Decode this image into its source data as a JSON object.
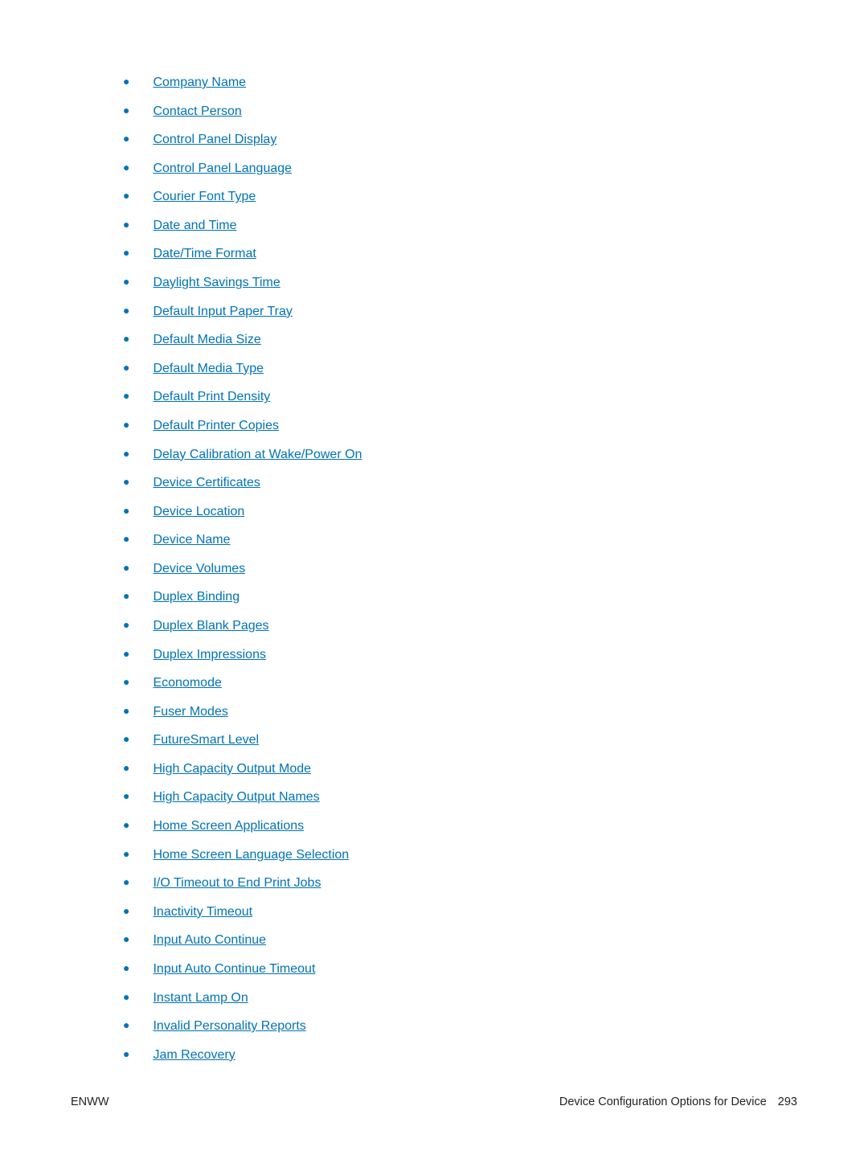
{
  "items": [
    "Company Name",
    "Contact Person",
    "Control Panel Display",
    "Control Panel Language",
    "Courier Font Type",
    "Date and Time",
    "Date/Time Format",
    "Daylight Savings Time",
    "Default Input Paper Tray",
    "Default Media Size",
    "Default Media Type",
    "Default Print Density",
    "Default Printer Copies",
    "Delay Calibration at Wake/Power On",
    "Device Certificates",
    "Device Location",
    "Device Name",
    "Device Volumes",
    "Duplex Binding",
    "Duplex Blank Pages",
    "Duplex Impressions",
    "Economode",
    "Fuser Modes",
    "FutureSmart Level",
    "High Capacity Output Mode",
    "High Capacity Output Names",
    "Home Screen Applications",
    "Home Screen Language Selection",
    "I/O Timeout to End Print Jobs",
    "Inactivity Timeout",
    "Input Auto Continue",
    "Input Auto Continue Timeout",
    "Instant Lamp On",
    "Invalid Personality Reports",
    "Jam Recovery"
  ],
  "footer": {
    "left": "ENWW",
    "right_text": "Device Configuration Options for Device",
    "page_number": "293"
  }
}
